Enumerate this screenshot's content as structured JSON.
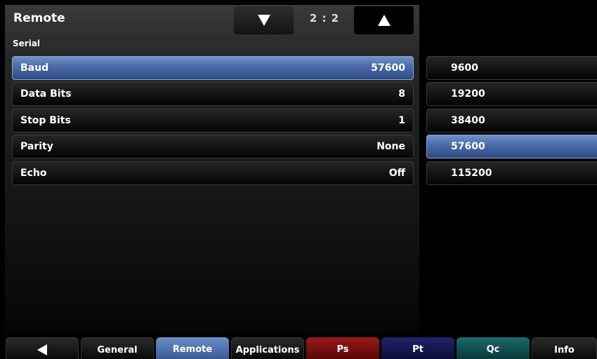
{
  "header": {
    "title": "Remote",
    "page_counter": "2 : 2",
    "down_icon": "triangle-down-icon",
    "up_icon": "triangle-up-icon"
  },
  "section": {
    "label": "Serial"
  },
  "settings": [
    {
      "label": "Baud",
      "value": "57600",
      "selected": true
    },
    {
      "label": "Data Bits",
      "value": "8",
      "selected": false
    },
    {
      "label": "Stop Bits",
      "value": "1",
      "selected": false
    },
    {
      "label": "Parity",
      "value": "None",
      "selected": false
    },
    {
      "label": "Echo",
      "value": "Off",
      "selected": false
    }
  ],
  "options": [
    {
      "label": "9600",
      "selected": false
    },
    {
      "label": "19200",
      "selected": false
    },
    {
      "label": "38400",
      "selected": false
    },
    {
      "label": "57600",
      "selected": true
    },
    {
      "label": "115200",
      "selected": false
    }
  ],
  "tabs": [
    {
      "label": "",
      "icon": "triangle-left-icon"
    },
    {
      "label": "General"
    },
    {
      "label": "Remote",
      "active": true
    },
    {
      "label": "Applications"
    },
    {
      "label": "Ps",
      "color": "#7a1010"
    },
    {
      "label": "Pt",
      "color": "#16164e"
    },
    {
      "label": "Qc",
      "color": "#125252"
    },
    {
      "label": "Info"
    }
  ],
  "colors": {
    "selected": "#4a6aa6",
    "background": "#000000"
  }
}
